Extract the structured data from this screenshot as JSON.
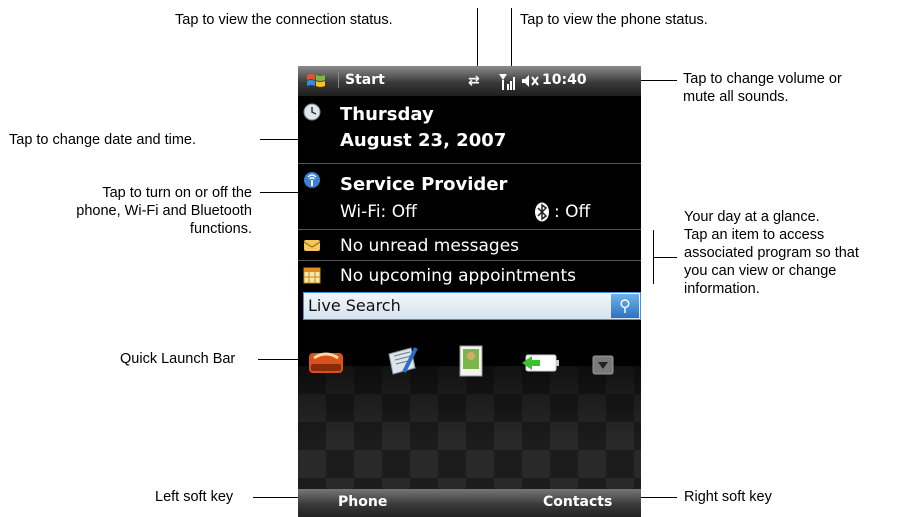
{
  "annotations": {
    "connection": "Tap to view the connection status.",
    "phone_status": "Tap to view the phone status.",
    "volume_line1": "Tap to change volume or",
    "volume_line2": "mute all sounds.",
    "date_time": "Tap to change date and time.",
    "radios_line1": "Tap to turn on or off the",
    "radios_line2": "phone, Wi-Fi and Bluetooth",
    "radios_line3": "functions.",
    "glance_line1": "Your day at a glance.",
    "glance_line2": "Tap an item to access",
    "glance_line3": "associated program so that",
    "glance_line4": "you can view or change",
    "glance_line5": "information.",
    "quick_launch": "Quick Launch Bar",
    "left_soft": "Left soft key",
    "right_soft": "Right soft key"
  },
  "phone": {
    "start_label": "Start",
    "clock": "10:40",
    "day": "Thursday",
    "date": "August 23, 2007",
    "provider": "Service Provider",
    "wifi": "Wi-Fi: Off",
    "bluetooth": ": Off",
    "messages": "No unread messages",
    "appointments": "No upcoming appointments",
    "search_label": "Live Search",
    "left_softkey": "Phone",
    "right_softkey": "Contacts"
  },
  "icons": [
    "windows-logo-icon",
    "connection-icon",
    "signal-icon",
    "volume-mute-icon",
    "clock-icon",
    "wireless-icon",
    "bluetooth-icon",
    "mail-icon",
    "calendar-icon",
    "search-icon",
    "menu-app-icon",
    "notes-app-icon",
    "picture-app-icon",
    "battery-app-icon",
    "expand-arrow-icon"
  ]
}
